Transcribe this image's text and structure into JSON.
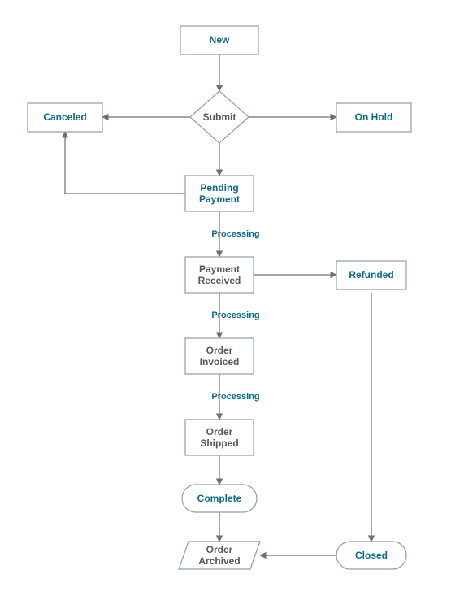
{
  "diagram": {
    "nodes": {
      "new": "New",
      "submit": "Submit",
      "canceled": "Canceled",
      "on_hold": "On Hold",
      "pending_payment_l1": "Pending",
      "pending_payment_l2": "Payment",
      "payment_received_l1": "Payment",
      "payment_received_l2": "Received",
      "refunded": "Refunded",
      "order_invoiced_l1": "Order",
      "order_invoiced_l2": "Invoiced",
      "order_shipped_l1": "Order",
      "order_shipped_l2": "Shipped",
      "complete": "Complete",
      "order_archived_l1": "Order",
      "order_archived_l2": "Archived",
      "closed": "Closed"
    },
    "edge_labels": {
      "processing_1": "Processing",
      "processing_2": "Processing",
      "processing_3": "Processing"
    }
  }
}
